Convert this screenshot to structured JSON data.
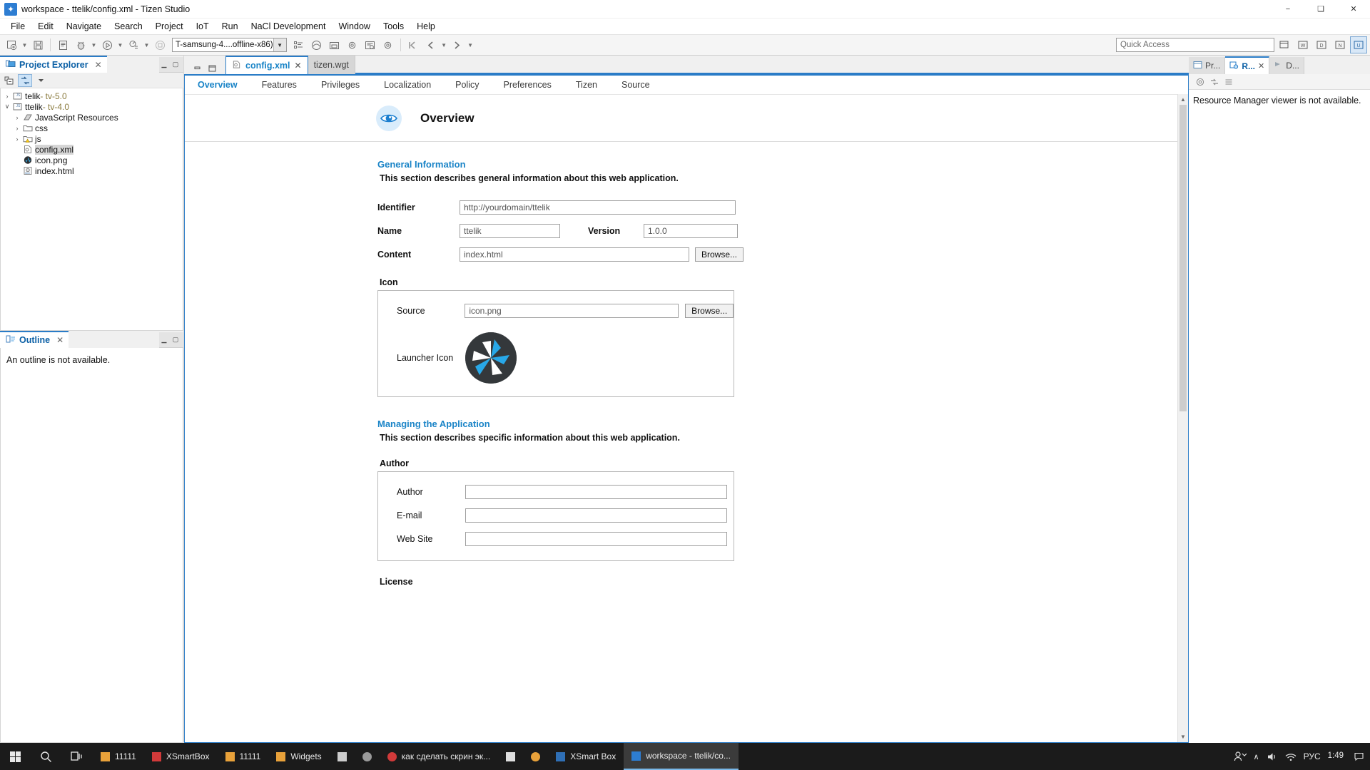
{
  "window": {
    "title": "workspace - ttelik/config.xml - Tizen Studio",
    "app_icon": "tizen-studio-icon",
    "minimize": "−",
    "maximize": "❑",
    "close": "✕"
  },
  "menubar": {
    "items": [
      {
        "label": "File",
        "name": "menu-file"
      },
      {
        "label": "Edit",
        "name": "menu-edit"
      },
      {
        "label": "Navigate",
        "name": "menu-navigate"
      },
      {
        "label": "Search",
        "name": "menu-search"
      },
      {
        "label": "Project",
        "name": "menu-project"
      },
      {
        "label": "IoT",
        "name": "menu-iot"
      },
      {
        "label": "Run",
        "name": "menu-run"
      },
      {
        "label": "NaCl Development",
        "name": "menu-nacl-development"
      },
      {
        "label": "Window",
        "name": "menu-window"
      },
      {
        "label": "Tools",
        "name": "menu-tools"
      },
      {
        "label": "Help",
        "name": "menu-help"
      }
    ]
  },
  "toolbar": {
    "device_selector": {
      "value": "T-samsung-4....offline-x86)",
      "name": "device-selector"
    },
    "quick_access": {
      "placeholder": "Quick Access",
      "value": ""
    }
  },
  "project_explorer": {
    "tab_label": "Project Explorer",
    "close": "✕",
    "tree": [
      {
        "indent": 0,
        "twisty": "›",
        "icon": "js-project-icon",
        "label": "telik",
        "suffix": " - tv-5.0",
        "selected": false,
        "name": "tree-item-telik"
      },
      {
        "indent": 0,
        "twisty": "∨",
        "icon": "js-project-icon",
        "label": "ttelik",
        "suffix": " - tv-4.0",
        "selected": false,
        "name": "tree-item-ttelik"
      },
      {
        "indent": 1,
        "twisty": "›",
        "icon": "js-resources-icon",
        "label": "JavaScript Resources",
        "suffix": "",
        "selected": false,
        "name": "tree-item-javascript-resources"
      },
      {
        "indent": 1,
        "twisty": "›",
        "icon": "folder-icon",
        "label": "css",
        "suffix": "",
        "selected": false,
        "name": "tree-item-css"
      },
      {
        "indent": 1,
        "twisty": "›",
        "icon": "folder-warning-icon",
        "label": "js",
        "suffix": "",
        "selected": false,
        "name": "tree-item-js"
      },
      {
        "indent": 2,
        "twisty": "",
        "icon": "config-xml-icon",
        "label": "config.xml",
        "suffix": "",
        "selected": true,
        "name": "tree-item-config-xml"
      },
      {
        "indent": 2,
        "twisty": "",
        "icon": "png-icon",
        "label": "icon.png",
        "suffix": "",
        "selected": false,
        "name": "tree-item-icon-png"
      },
      {
        "indent": 2,
        "twisty": "",
        "icon": "html-icon",
        "label": "index.html",
        "suffix": "",
        "selected": false,
        "name": "tree-item-index-html"
      }
    ]
  },
  "outline": {
    "tab_label": "Outline",
    "close": "✕",
    "message": "An outline is not available."
  },
  "editor": {
    "tabs": [
      {
        "label": "config.xml",
        "active": true,
        "closable": true,
        "name": "editor-tab-config-xml"
      },
      {
        "label": "tizen.wgt",
        "active": false,
        "closable": false,
        "name": "editor-tab-tizen-wgt"
      }
    ],
    "close": "✕",
    "form_tabs": [
      {
        "label": "Overview",
        "active": true,
        "name": "form-tab-overview"
      },
      {
        "label": "Features",
        "active": false,
        "name": "form-tab-features"
      },
      {
        "label": "Privileges",
        "active": false,
        "name": "form-tab-privileges"
      },
      {
        "label": "Localization",
        "active": false,
        "name": "form-tab-localization"
      },
      {
        "label": "Policy",
        "active": false,
        "name": "form-tab-policy"
      },
      {
        "label": "Preferences",
        "active": false,
        "name": "form-tab-preferences"
      },
      {
        "label": "Tizen",
        "active": false,
        "name": "form-tab-tizen"
      },
      {
        "label": "Source",
        "active": false,
        "name": "form-tab-source"
      }
    ],
    "overview": {
      "header_title": "Overview",
      "header_icon": "eye-icon",
      "general": {
        "heading": "General Information",
        "description": "This section describes general information about this web application.",
        "identifier_label": "Identifier",
        "identifier_value": "http://yourdomain/ttelik",
        "name_label": "Name",
        "name_value": "ttelik",
        "version_label": "Version",
        "version_value": "1.0.0",
        "content_label": "Content",
        "content_value": "index.html",
        "content_browse": "Browse...",
        "icon_group_label": "Icon",
        "icon_source_label": "Source",
        "icon_source_value": "icon.png",
        "icon_browse": "Browse...",
        "launcher_icon_label": "Launcher Icon",
        "launcher_icon_name": "tizen-pinwheel-icon"
      },
      "managing": {
        "heading": "Managing the Application",
        "description": "This section describes specific information about this web application.",
        "author_group_label": "Author",
        "author_label": "Author",
        "author_value": "",
        "email_label": "E-mail",
        "email_value": "",
        "website_label": "Web Site",
        "website_value": "",
        "license_group_label": "License"
      }
    }
  },
  "right_panel": {
    "tabs": [
      {
        "label": "Pr...",
        "active": false,
        "closable": false,
        "name": "right-tab-properties"
      },
      {
        "label": "R...",
        "active": true,
        "closable": true,
        "name": "right-tab-resource-manager"
      },
      {
        "label": "D...",
        "active": false,
        "closable": false,
        "name": "right-tab-device-manager"
      }
    ],
    "close": "✕",
    "message": "Resource Manager viewer is not available."
  },
  "taskbar": {
    "start": "start-icon",
    "search": "search-icon",
    "taskview": "task-view-icon",
    "apps": [
      {
        "label": "11111",
        "icon_color": "#e8a13a",
        "active": false,
        "name": "taskbar-item-11111-a"
      },
      {
        "label": "XSmartBox",
        "icon_color": "#d13a3a",
        "active": false,
        "name": "taskbar-item-xsmartbox"
      },
      {
        "label": "11111",
        "icon_color": "#e8a13a",
        "active": false,
        "name": "taskbar-item-11111-b"
      },
      {
        "label": "Widgets",
        "icon_color": "#e8a13a",
        "active": false,
        "name": "taskbar-item-widgets"
      },
      {
        "label": "",
        "icon_color": "#cccccc",
        "active": false,
        "name": "taskbar-item-explorer"
      },
      {
        "label": "",
        "icon_color": "#9a9a9a",
        "active": false,
        "name": "taskbar-item-utility"
      },
      {
        "label": "как сделать скрин эк...",
        "icon_color": "#d13a3a",
        "active": false,
        "name": "taskbar-item-browser-video"
      },
      {
        "label": "",
        "icon_color": "#dedede",
        "active": false,
        "name": "taskbar-item-mail"
      },
      {
        "label": "",
        "icon_color": "#e8a13a",
        "active": false,
        "name": "taskbar-item-chrome"
      },
      {
        "label": "XSmart Box",
        "icon_color": "#2f6fb5",
        "active": false,
        "name": "taskbar-item-xsmart-box"
      },
      {
        "label": "workspace - ttelik/co...",
        "icon_color": "#2d7dd2",
        "active": true,
        "name": "taskbar-item-tizen-studio"
      }
    ],
    "tray": {
      "people": "people-icon",
      "chevron": "∧",
      "volume": "volume-icon",
      "network": "network-icon",
      "language": "РУС",
      "time": "1:49",
      "notifications": "notification-icon"
    }
  },
  "colors": {
    "accent": "#2a7cc7",
    "link": "#1a84c7",
    "tab_active_text": "#0a5fa5",
    "taskbar_bg": "#1b1b1b"
  }
}
